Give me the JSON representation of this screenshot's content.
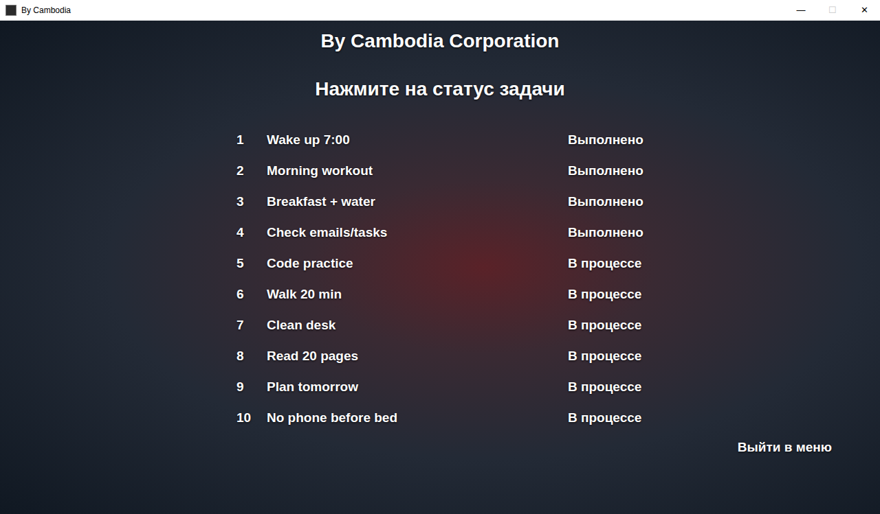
{
  "window": {
    "title": "By Cambodia",
    "buttons": [
      {
        "glyph": "—",
        "disabled": false
      },
      {
        "glyph": "☐",
        "disabled": true
      },
      {
        "glyph": "✕",
        "disabled": false
      }
    ]
  },
  "heading": "By Cambodia Corporation",
  "subtitle": "Нажмите на статус задачи",
  "tasks": [
    {
      "number": "1",
      "name": "Wake up 7:00",
      "status": "Выполнено"
    },
    {
      "number": "2",
      "name": "Morning workout",
      "status": "Выполнено"
    },
    {
      "number": "3",
      "name": "Breakfast + water",
      "status": "Выполнено"
    },
    {
      "number": "4",
      "name": "Check emails/tasks",
      "status": "Выполнено"
    },
    {
      "number": "5",
      "name": "Code practice",
      "status": "В процессе"
    },
    {
      "number": "6",
      "name": "Walk 20 min",
      "status": "В процессе"
    },
    {
      "number": "7",
      "name": "Clean desk",
      "status": "В процессе"
    },
    {
      "number": "8",
      "name": "Read 20 pages",
      "status": "В процессе"
    },
    {
      "number": "9",
      "name": "Plan tomorrow",
      "status": "В процессе"
    },
    {
      "number": "10",
      "name": "No phone before bed",
      "status": "В процессе"
    }
  ],
  "exit_button": "Выйти в меню"
}
